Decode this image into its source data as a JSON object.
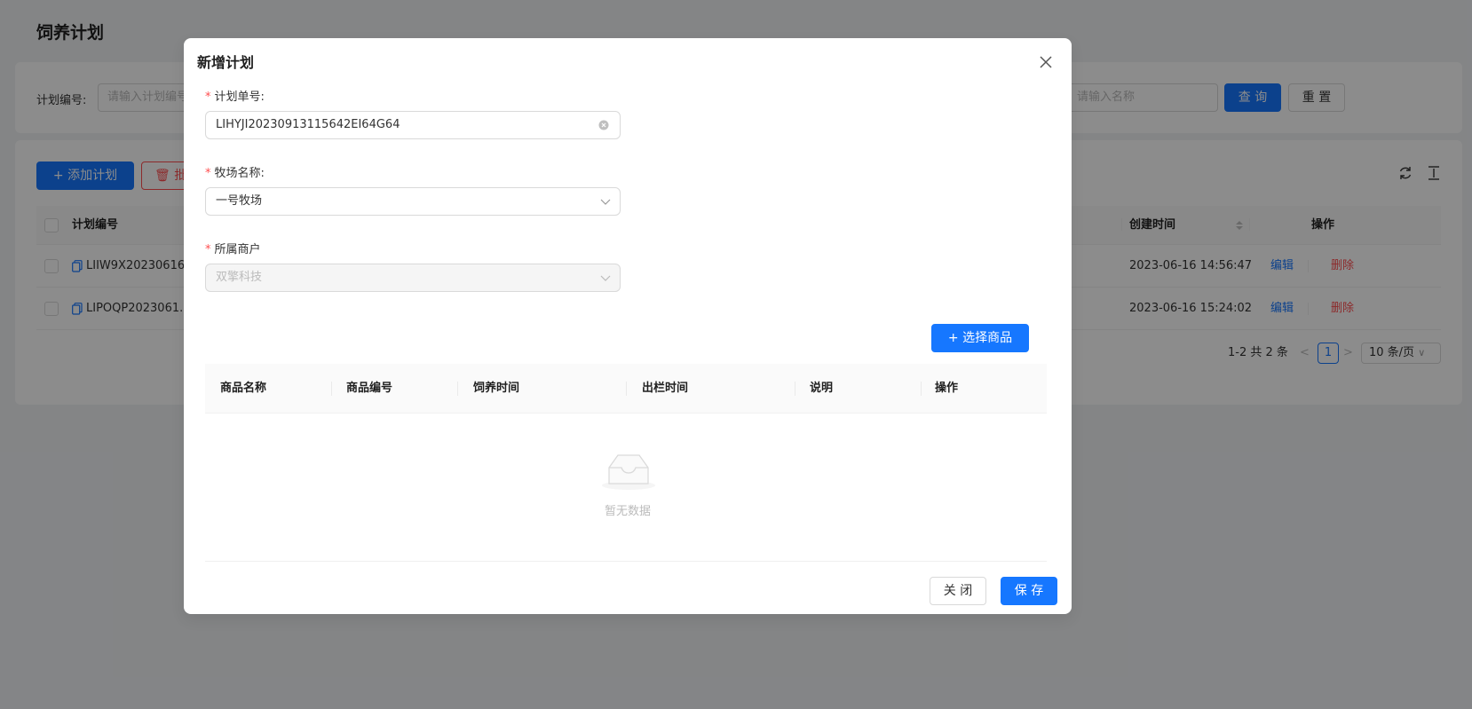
{
  "page": {
    "title": "饲养计划",
    "search": {
      "label": "计划编号:",
      "placeholder": "请输入计划编号",
      "placeholder2": "请输入名称",
      "query_button": "查 询",
      "reset_button": "重 置"
    },
    "toolbar": {
      "add_button": "添加计划",
      "batch_button": "批"
    },
    "table": {
      "headers": [
        "计划编号",
        "创建时间",
        "操作"
      ],
      "rows": [
        {
          "id": "LIIW9X20230616...",
          "created": "2023-06-16 14:56:47",
          "edit": "编辑",
          "delete": "删除"
        },
        {
          "id": "LIPOQP2023061...",
          "created": "2023-06-16 15:24:02",
          "edit": "编辑",
          "delete": "删除"
        }
      ]
    },
    "pager": {
      "total": "1-2 共 2 条",
      "current": "1",
      "page_size": "10 条/页"
    }
  },
  "modal": {
    "title": "新增计划",
    "fields": {
      "plan_no_label": "计划单号:",
      "plan_no_value": "LIHYJI20230913115642EI64G64",
      "farm_label": "牧场名称:",
      "farm_value": "一号牧场",
      "merchant_label": "所属商户",
      "merchant_value": "双擎科技"
    },
    "select_goods_button": "选择商品",
    "goods_table": {
      "headers": [
        "商品名称",
        "商品编号",
        "饲养时间",
        "出栏时间",
        "说明",
        "操作"
      ],
      "empty_text": "暂无数据"
    },
    "close_button": "关 闭",
    "save_button": "保 存"
  },
  "colors": {
    "primary": "#1677ff",
    "danger": "#ff4d4f",
    "mask": "rgba(0,0,0,0.45)"
  }
}
